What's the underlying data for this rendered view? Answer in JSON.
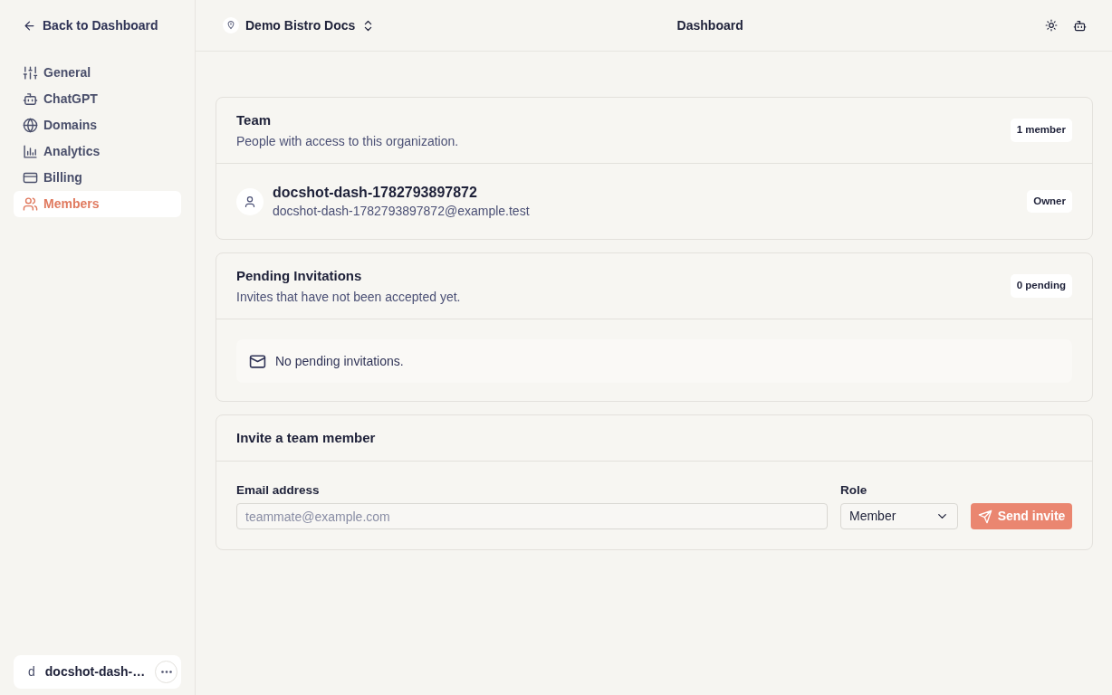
{
  "sidebar": {
    "back_link": "Back to Dashboard",
    "items": [
      {
        "label": "General",
        "selected": false
      },
      {
        "label": "ChatGPT",
        "selected": false
      },
      {
        "label": "Domains",
        "selected": false
      },
      {
        "label": "Analytics",
        "selected": false
      },
      {
        "label": "Billing",
        "selected": false
      },
      {
        "label": "Members",
        "selected": true
      }
    ],
    "user": {
      "initial": "d",
      "name": "docshot-dash-…"
    }
  },
  "header": {
    "organization": "Demo Bistro Docs",
    "title": "Dashboard"
  },
  "team": {
    "title": "Team",
    "subtitle": "People with access to this organization.",
    "count": "1 member",
    "members": [
      {
        "name": "docshot-dash-1782793897872",
        "email": "docshot-dash-1782793897872@example.test",
        "role": "Owner"
      }
    ]
  },
  "pending_invitations": {
    "title": "Pending Invitations",
    "subtitle": "Invites that have not been accepted yet.",
    "count": "0 pending",
    "empty_message": "No pending invitations."
  },
  "invite_form": {
    "title": "Invite a team member",
    "email": {
      "label": "Email address",
      "placeholder": "teammate@example.com"
    },
    "role": {
      "label": "Role",
      "value": "Member"
    },
    "submit": "Send invite"
  }
}
